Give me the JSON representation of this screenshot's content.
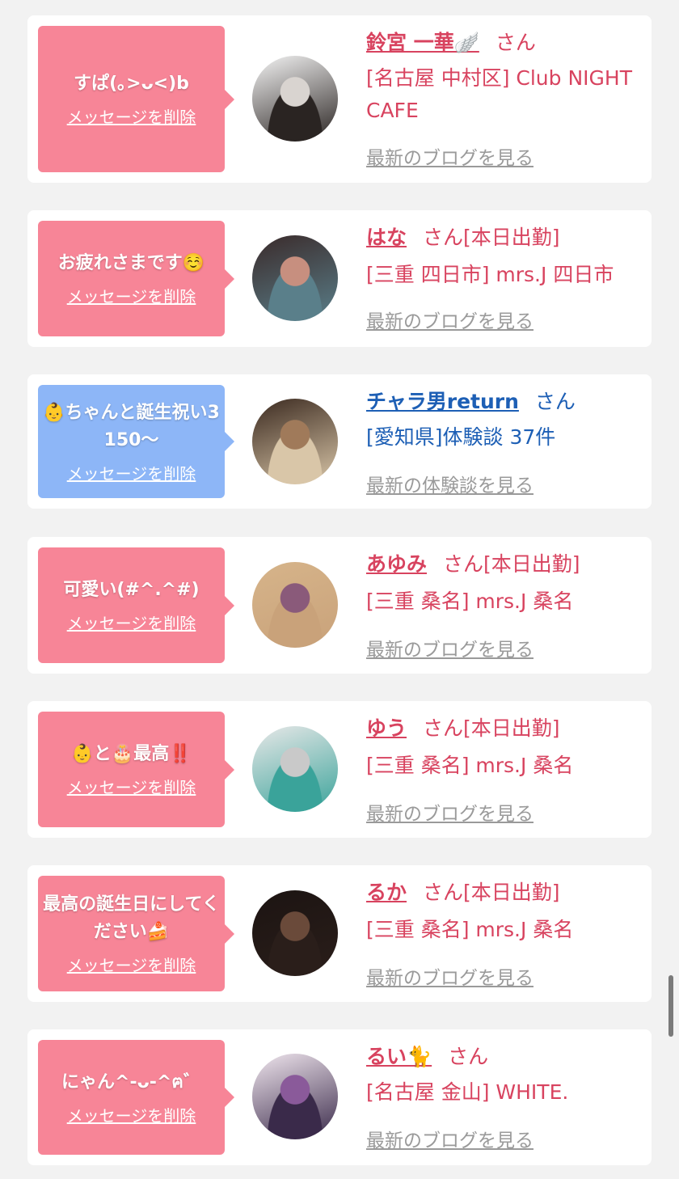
{
  "messages": [
    {
      "message": "すぱ(｡>ᴗ<)b",
      "delete_label": "メッセージを削除",
      "bubble_color": "#f78597",
      "avatar_icon": "woman-portrait-icon",
      "avatar_gradient": [
        "#f4f4f4",
        "#d9d4d0",
        "#2a2422"
      ],
      "name": "鈴宮 一華🪽",
      "name_color": "#d8435f",
      "suffix": "さん",
      "shop": "[名古屋 中村区] Club NIGHT CAFE",
      "link": "最新のブログを見る"
    },
    {
      "message": "お疲れさまです☺️",
      "delete_label": "メッセージを削除",
      "bubble_color": "#f78597",
      "avatar_icon": "woman-selfie-icon",
      "avatar_gradient": [
        "#3a2a2a",
        "#c78f7f",
        "#5a7f8a"
      ],
      "name": "はな",
      "name_color": "#d8435f",
      "suffix": "さん[本日出勤]",
      "shop": "[三重 四日市] mrs.J 四日市",
      "link": "最新のブログを見る"
    },
    {
      "message": "👶ちゃんと誕生祝い3150〜",
      "delete_label": "メッセージを削除",
      "bubble_color": "#8db6f7",
      "avatar_icon": "cafe-photo-icon",
      "avatar_gradient": [
        "#3b2a20",
        "#a07a5a",
        "#d9c6a8"
      ],
      "name": "チャラ男return",
      "name_color": "#1d5fb5",
      "suffix": "さん",
      "shop": "[愛知県]体験談 37件",
      "link": "最新の体験談を見る"
    },
    {
      "message": "可愛い(#^.^#)",
      "delete_label": "メッセージを削除",
      "bubble_color": "#f78597",
      "avatar_icon": "woman-flowers-icon",
      "avatar_gradient": [
        "#d6b48a",
        "#8a5a7a",
        "#c9a27a"
      ],
      "name": "あゆみ",
      "name_color": "#d8435f",
      "suffix": "さん[本日出勤]",
      "shop": "[三重 桑名] mrs.J 桑名",
      "link": "最新のブログを見る"
    },
    {
      "message": "👶と🎂最高‼️",
      "delete_label": "メッセージを削除",
      "bubble_color": "#f78597",
      "avatar_icon": "angel-figurine-icon",
      "avatar_gradient": [
        "#e8e8e8",
        "#c9c9c9",
        "#3aa39a"
      ],
      "name": "ゆう",
      "name_color": "#d8435f",
      "suffix": "さん[本日出勤]",
      "shop": "[三重 桑名] mrs.J 桑名",
      "link": "最新のブログを見る"
    },
    {
      "message": "最高の誕生日にしてください🍰",
      "delete_label": "メッセージを削除",
      "bubble_color": "#f78597",
      "avatar_icon": "woman-heart-icon",
      "avatar_gradient": [
        "#1c1412",
        "#6a4a3a",
        "#2a1e1a"
      ],
      "name": "るか",
      "name_color": "#d8435f",
      "suffix": "さん[本日出勤]",
      "shop": "[三重 桑名] mrs.J 桑名",
      "link": "最新のブログを見る"
    },
    {
      "message": "にゃん^-ᴗ-^ฅ゛",
      "delete_label": "メッセージを削除",
      "bubble_color": "#f78597",
      "avatar_icon": "woman-mirror-icon",
      "avatar_gradient": [
        "#f0e6ee",
        "#8a5a9a",
        "#3a2a4a"
      ],
      "name": "るい🐈",
      "name_color": "#d8435f",
      "suffix": "さん",
      "shop": "[名古屋 金山] WHITE.",
      "link": "最新のブログを見る"
    }
  ]
}
